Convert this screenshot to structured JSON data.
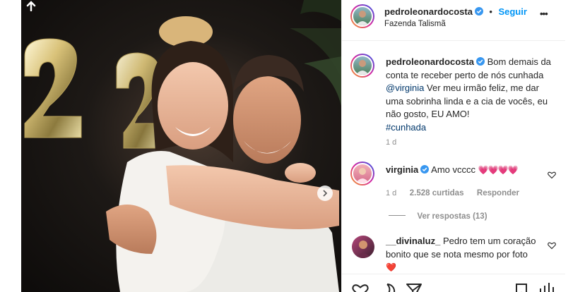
{
  "post": {
    "author": "pedroleonardocosta",
    "follow_label": "Seguir",
    "location": "Fazenda Talismã",
    "more_label": "•••"
  },
  "caption": {
    "author": "pedroleonardocosta",
    "text_1": "Bom demais da conta te receber perto de nós cunhada",
    "mention": "@virginia",
    "text_2": "Ver meu irmão feliz, me dar uma sobrinha linda e a cia de vocês, eu não gosto, EU AMO!",
    "hashtag": "#cunhada",
    "time": "1 d"
  },
  "comments": [
    {
      "author": "virginia",
      "text": "Amo vcccc",
      "emoji": "💗💗💗💗",
      "time": "1 d",
      "likes": "2.528 curtidas",
      "reply_label": "Responder",
      "replies_label": "Ver respostas (13)"
    },
    {
      "author": "__divinaluz_",
      "text": "Pedro tem um coração bonito que se nota mesmo por foto",
      "emoji": "❤️"
    }
  ],
  "photo": {
    "balloon_digit": "2"
  },
  "colors": {
    "link_blue": "#0095f6",
    "mention": "#00376b",
    "verified": "#3897f0",
    "muted": "#8e8e8e",
    "heart_pink": "#ff4fa3"
  }
}
